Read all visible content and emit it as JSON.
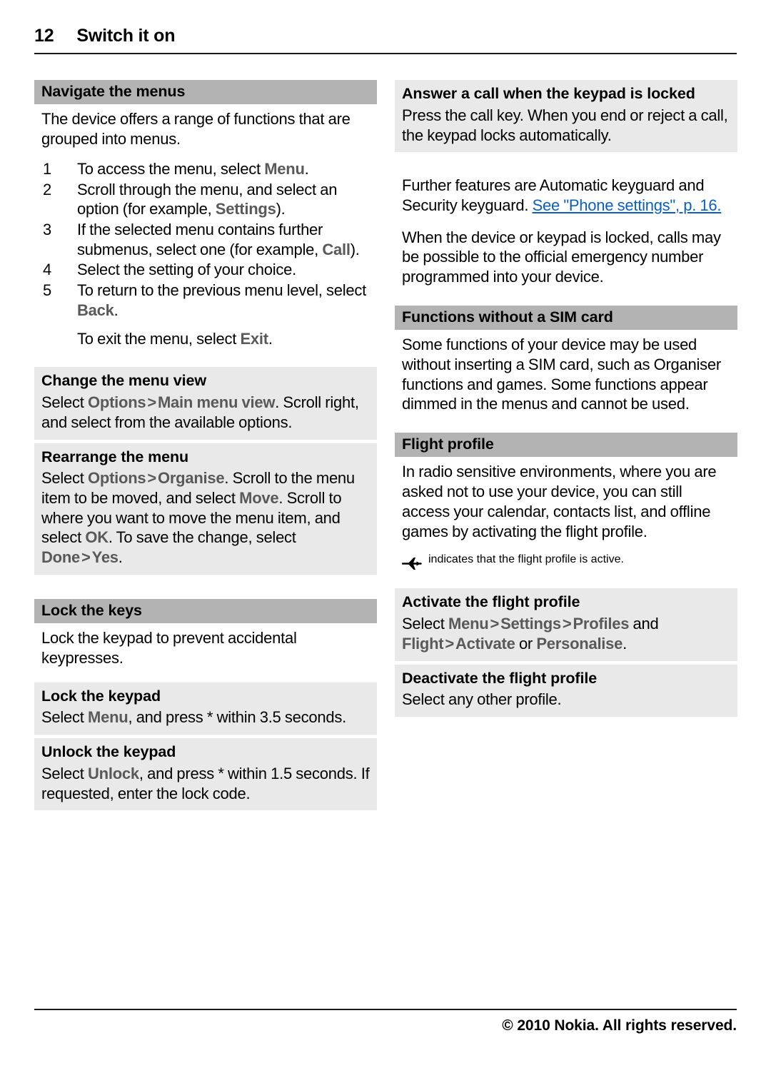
{
  "header": {
    "page_number": "12",
    "title": "Switch it on"
  },
  "colors": {
    "section_header_band": "#b3b3b3",
    "content_box": "#e9e9e9",
    "ui_term": "#595959",
    "link": "#0b5fc4",
    "rule": "#1a1a1a"
  },
  "left_column": {
    "navigate": {
      "heading": "Navigate the menus",
      "intro": "The device offers a range of functions that are grouped into menus.",
      "steps": [
        {
          "num": "1",
          "parts": [
            {
              "t": "text",
              "v": "To access the menu, select "
            },
            {
              "t": "ui",
              "v": "Menu"
            },
            {
              "t": "text",
              "v": "."
            }
          ]
        },
        {
          "num": "2",
          "parts": [
            {
              "t": "text",
              "v": "Scroll through the menu, and select an option (for example, "
            },
            {
              "t": "ui",
              "v": "Settings"
            },
            {
              "t": "text",
              "v": ")."
            }
          ]
        },
        {
          "num": "3",
          "parts": [
            {
              "t": "text",
              "v": "If the selected menu contains further submenus, select one (for example, "
            },
            {
              "t": "ui",
              "v": "Call"
            },
            {
              "t": "text",
              "v": ")."
            }
          ]
        },
        {
          "num": "4",
          "parts": [
            {
              "t": "text",
              "v": "Select the setting of your choice."
            }
          ]
        },
        {
          "num": "5",
          "parts": [
            {
              "t": "text",
              "v": "To return to the previous menu level, select "
            },
            {
              "t": "ui",
              "v": "Back"
            },
            {
              "t": "text",
              "v": "."
            }
          ]
        }
      ],
      "exit_note_prefix": "To exit the menu, select ",
      "exit_note_ui": "Exit",
      "exit_note_suffix": "."
    },
    "change_menu_view": {
      "heading": "Change the menu view",
      "body_prefix": "Select ",
      "body_ui1": "Options",
      "body_sep": ">",
      "body_ui2": "Main menu view",
      "body_suffix": ". Scroll right, and select from the available options."
    },
    "rearrange_menu": {
      "heading": "Rearrange the menu",
      "seg1": "Select ",
      "ui_options": "Options",
      "sep1": ">",
      "ui_organise": "Organise",
      "seg2": ". Scroll to the menu item to be moved, and select ",
      "ui_move": "Move",
      "seg3": ". Scroll to where you want to move the menu item, and select ",
      "ui_ok": "OK",
      "seg4": ". To save the change, select ",
      "ui_done": "Done",
      "sep2": ">",
      "ui_yes": "Yes",
      "seg5": "."
    },
    "lock_the_keys": {
      "heading": "Lock the keys",
      "body": "Lock the keypad to prevent accidental keypresses."
    },
    "lock_the_keypad": {
      "heading": "Lock the keypad",
      "prefix": "Select ",
      "ui": "Menu",
      "suffix": ", and press * within 3.5 seconds."
    },
    "unlock_the_keypad": {
      "heading": "Unlock the keypad",
      "prefix": "Select ",
      "ui": "Unlock",
      "suffix": ", and press * within 1.5 seconds. If requested, enter the lock code."
    }
  },
  "right_column": {
    "answer_call": {
      "heading": "Answer a call when the keypad is locked",
      "body": "Press the call key. When you end or reject a call, the keypad locks automatically."
    },
    "further_features": {
      "text_before_link": "Further features are Automatic keyguard and Security keyguard. ",
      "link_text": "See \"Phone settings\", p. 16."
    },
    "emergency_note": "When the device or keypad is locked, calls may be possible to the official emergency number programmed into your device.",
    "functions_no_sim": {
      "heading": "Functions without a SIM card",
      "body": "Some functions of your device may be used without inserting a SIM card, such as Organiser functions and games. Some functions appear dimmed in the menus and cannot be used."
    },
    "flight_profile": {
      "heading": "Flight profile",
      "body": "In radio sensitive environments, where you are asked not to use your device, you can still access your calendar, contacts list, and offline games by activating the flight profile.",
      "icon_name": "airplane-icon",
      "icon_glyph": "✈",
      "icon_note": "indicates that the flight profile is active."
    },
    "activate_flight": {
      "heading": "Activate the flight profile",
      "seg1": "Select ",
      "ui_menu": "Menu",
      "sep1": ">",
      "ui_settings": "Settings",
      "sep2": ">",
      "ui_profiles": "Profiles",
      "seg2": " and ",
      "ui_flight": "Flight",
      "sep3": ">",
      "ui_activate": "Activate",
      "seg3": " or ",
      "ui_personalise": "Personalise",
      "seg4": "."
    },
    "deactivate_flight": {
      "heading": "Deactivate the flight profile",
      "body": "Select any other profile."
    }
  },
  "footer": {
    "copyright": "© 2010 Nokia. All rights reserved."
  }
}
